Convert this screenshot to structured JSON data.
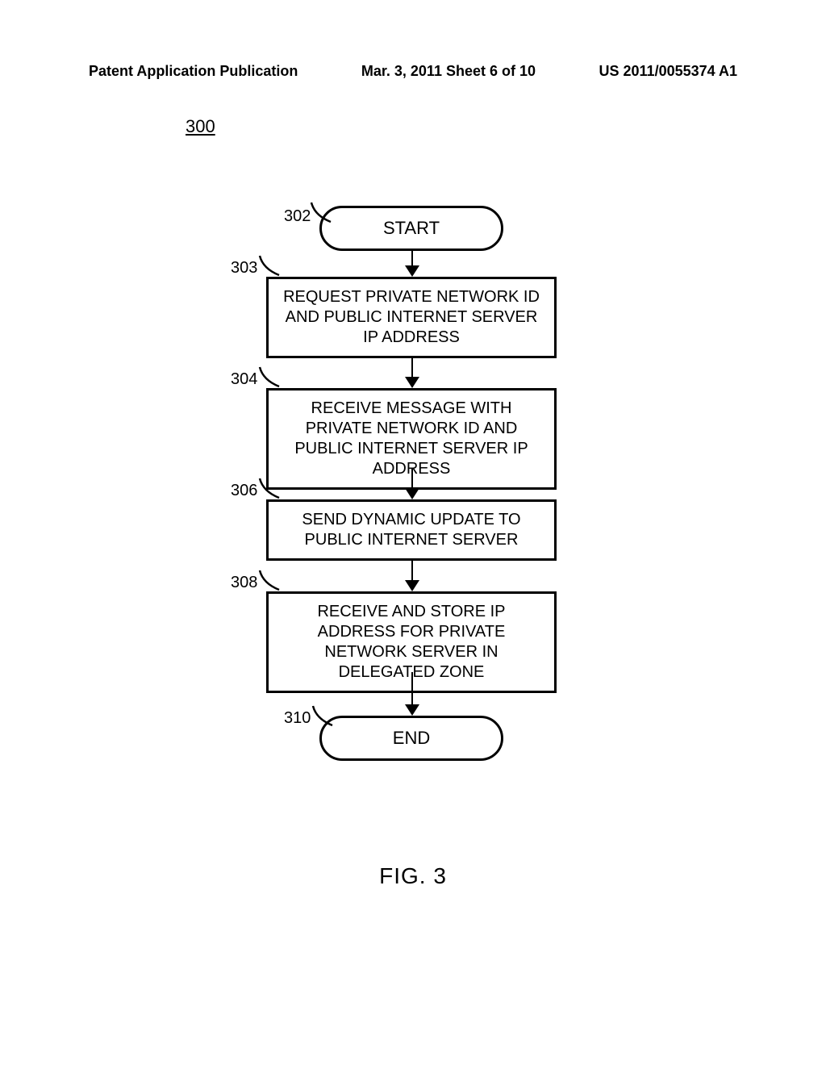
{
  "header": {
    "left": "Patent Application Publication",
    "center": "Mar. 3, 2011  Sheet 6 of 10",
    "right": "US 2011/0055374 A1"
  },
  "figure_number": "300",
  "fig_caption": "FIG. 3",
  "nodes": {
    "start": {
      "ref": "302",
      "label": "START"
    },
    "step1": {
      "ref": "303",
      "label": "REQUEST PRIVATE NETWORK ID AND PUBLIC INTERNET SERVER IP ADDRESS"
    },
    "step2": {
      "ref": "304",
      "label": "RECEIVE MESSAGE WITH PRIVATE NETWORK ID AND PUBLIC INTERNET SERVER IP ADDRESS"
    },
    "step3": {
      "ref": "306",
      "label": "SEND DYNAMIC UPDATE TO PUBLIC INTERNET SERVER"
    },
    "step4": {
      "ref": "308",
      "label": "RECEIVE AND STORE IP ADDRESS FOR PRIVATE NETWORK SERVER IN DELEGATED ZONE"
    },
    "end": {
      "ref": "310",
      "label": "END"
    }
  }
}
